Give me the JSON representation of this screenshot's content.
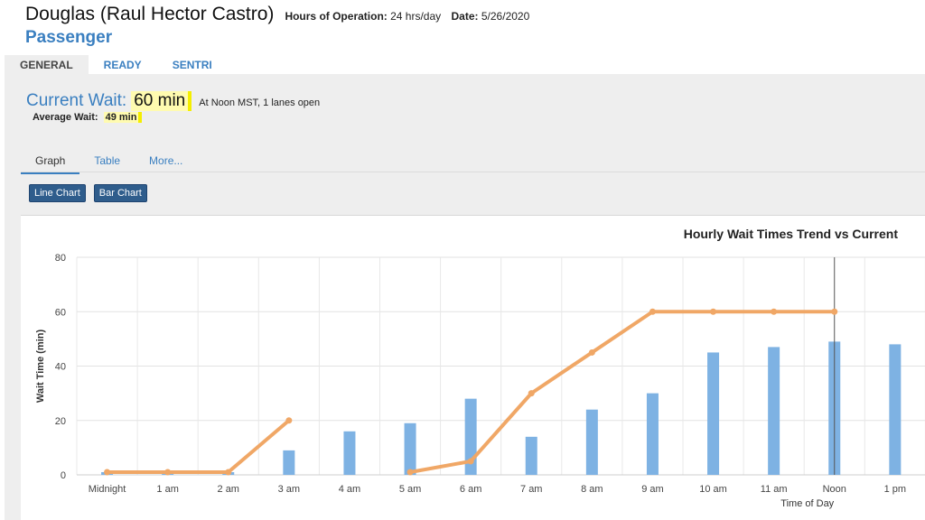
{
  "header": {
    "port_name": "Douglas (Raul Hector Castro)",
    "hours_label": "Hours of Operation:",
    "hours_value": "24 hrs/day",
    "date_label": "Date:",
    "date_value": "5/26/2020",
    "lane_type": "Passenger"
  },
  "tabs": [
    {
      "label": "GENERAL",
      "active": true
    },
    {
      "label": "READY",
      "active": false
    },
    {
      "label": "SENTRI",
      "active": false
    }
  ],
  "current_wait": {
    "label": "Current Wait:",
    "value": "60 min",
    "note": "At Noon MST, 1 lanes open"
  },
  "average_wait": {
    "label": "Average Wait:",
    "value": "49 min"
  },
  "subtabs": [
    {
      "label": "Graph",
      "active": true
    },
    {
      "label": "Table",
      "active": false
    },
    {
      "label": "More...",
      "active": false
    }
  ],
  "buttons": {
    "line_chart": "Line Chart",
    "bar_chart": "Bar Chart"
  },
  "colors": {
    "bar": "#7eb2e3",
    "line": "#f0a766",
    "accent": "#3a7fc0"
  },
  "chart_data": {
    "type": "bar",
    "title": "Hourly Wait Times Trend vs Current",
    "xlabel": "Time of Day",
    "ylabel": "Wait Time (min)",
    "ylim": [
      0,
      80
    ],
    "yticks": [
      0,
      20,
      40,
      60,
      80
    ],
    "grid": true,
    "categories": [
      "Midnight",
      "1 am",
      "2 am",
      "3 am",
      "4 am",
      "5 am",
      "6 am",
      "7 am",
      "8 am",
      "9 am",
      "10 am",
      "11 am",
      "Noon",
      "1 pm"
    ],
    "series": [
      {
        "kind": "bar",
        "values": [
          1,
          1,
          1,
          9,
          16,
          19,
          28,
          14,
          24,
          30,
          45,
          47,
          49,
          48
        ]
      },
      {
        "kind": "line",
        "segments": [
          [
            [
              0,
              1
            ],
            [
              1,
              1
            ],
            [
              2,
              1
            ],
            [
              3,
              20
            ]
          ],
          [
            [
              5,
              1
            ],
            [
              6,
              5
            ],
            [
              7,
              30
            ],
            [
              8,
              45
            ],
            [
              9,
              60
            ],
            [
              10,
              60
            ],
            [
              11,
              60
            ],
            [
              12,
              60
            ]
          ]
        ]
      }
    ],
    "current_marker": "Noon"
  }
}
